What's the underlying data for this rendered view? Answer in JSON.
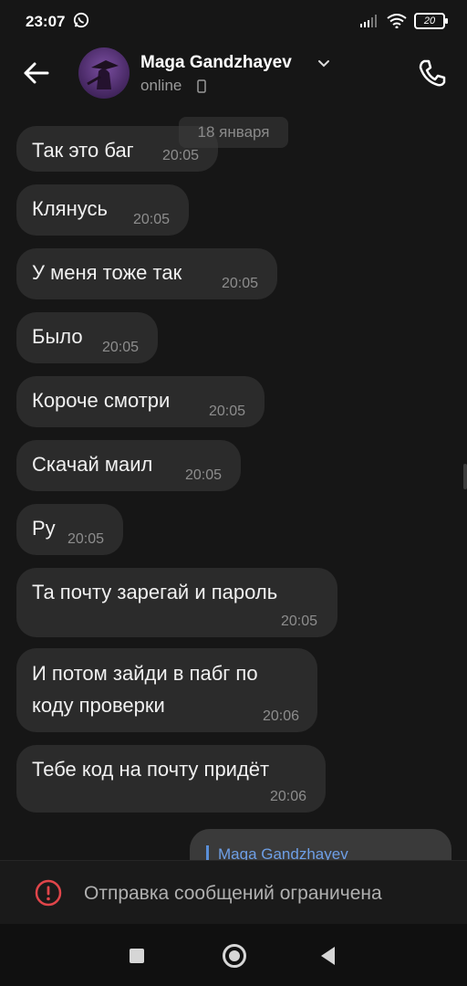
{
  "status_bar": {
    "time": "23:07",
    "battery": "20",
    "icons": [
      "whatsapp-icon",
      "signal-icon",
      "wifi-icon",
      "battery-icon"
    ]
  },
  "header": {
    "contact_name": "Maga Gandzhayev",
    "status": "online",
    "icons": [
      "back-arrow-icon",
      "chevron-down-icon",
      "mobile-device-icon",
      "phone-call-icon"
    ]
  },
  "chat": {
    "date_label": "18 января",
    "messages": [
      {
        "text": "Так это баг",
        "time": "20:05"
      },
      {
        "text": "Клянусь",
        "time": "20:05"
      },
      {
        "text": "У меня тоже так",
        "time": "20:05"
      },
      {
        "text": "Было",
        "time": "20:05"
      },
      {
        "text": "Короче смотри",
        "time": "20:05"
      },
      {
        "text": "Скачай маил",
        "time": "20:05"
      },
      {
        "text": "Ру",
        "time": "20:05"
      },
      {
        "text": "Та почту зарегай и пароль",
        "time": "20:05"
      },
      {
        "text_line1": "И потом зайди в пабг по",
        "text_line2": "коду проверки",
        "time": "20:06"
      },
      {
        "text": "Тебе код на почту придёт",
        "time": "20:06"
      }
    ],
    "outgoing_reply_name": "Maga Gandzhayev"
  },
  "restriction_banner": {
    "text": "Отправка сообщений ограничена",
    "icon": "warning-circle-icon",
    "accent": "#e0454a"
  },
  "nav_bar": {
    "icons": [
      "recent-apps-icon",
      "home-icon",
      "back-icon"
    ]
  }
}
